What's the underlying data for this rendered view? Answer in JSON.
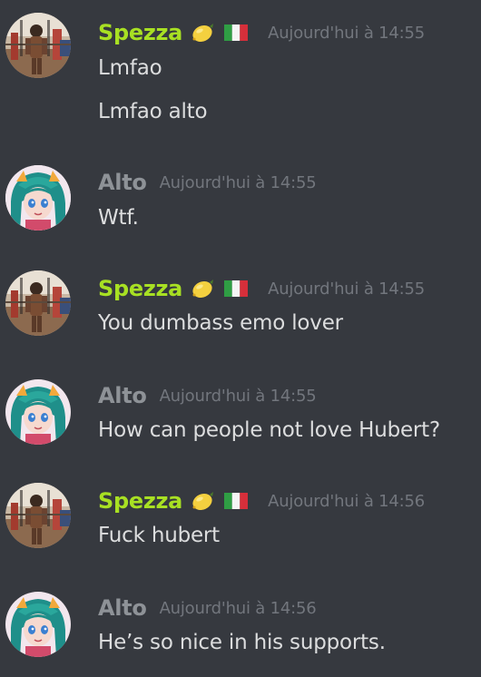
{
  "colors": {
    "background": "#36393f",
    "spezza_name": "#a8e023",
    "alto_name": "#8e9297",
    "message_text": "#dcddde",
    "timestamp": "#72767d"
  },
  "messages": [
    {
      "author": "Spezza",
      "badges": [
        "lemon-icon",
        "italy-flag-icon"
      ],
      "timestamp": "Aujourd'hui à 14:55",
      "lines": [
        "Lmfao",
        "Lmfao alto"
      ]
    },
    {
      "author": "Alto",
      "badges": [],
      "timestamp": "Aujourd'hui à 14:55",
      "lines": [
        "Wtf."
      ]
    },
    {
      "author": "Spezza",
      "badges": [
        "lemon-icon",
        "italy-flag-icon"
      ],
      "timestamp": "Aujourd'hui à 14:55",
      "lines": [
        "You dumbass emo lover"
      ]
    },
    {
      "author": "Alto",
      "badges": [],
      "timestamp": "Aujourd'hui à 14:55",
      "lines": [
        "How can people not love Hubert?"
      ]
    },
    {
      "author": "Spezza",
      "badges": [
        "lemon-icon",
        "italy-flag-icon"
      ],
      "timestamp": "Aujourd'hui à 14:56",
      "lines": [
        "Fuck hubert"
      ]
    },
    {
      "author": "Alto",
      "badges": [],
      "timestamp": "Aujourd'hui à 14:56",
      "lines": [
        "He’s so nice in his supports."
      ]
    }
  ]
}
